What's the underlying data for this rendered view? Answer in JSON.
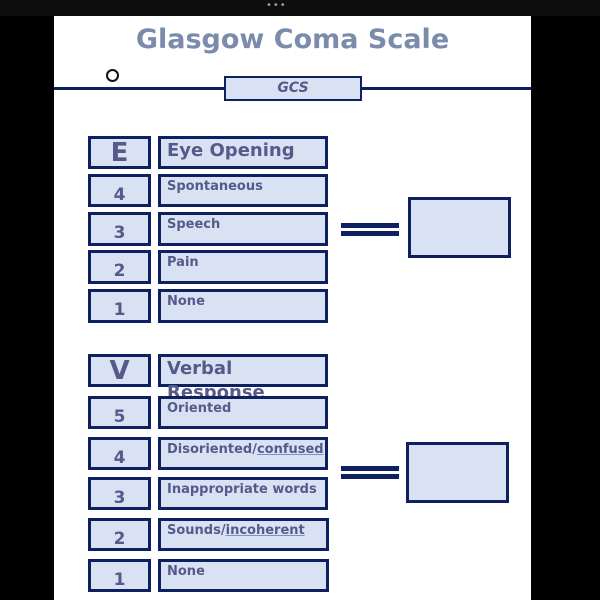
{
  "window": {
    "menu_dots": "•••"
  },
  "document": {
    "title": "Glasgow Coma Scale",
    "badge": "GCS",
    "sections": [
      {
        "letter": "E",
        "heading": "Eye Opening",
        "rows": [
          {
            "score": "4",
            "label": "Spontaneous"
          },
          {
            "score": "3",
            "label": "Speech"
          },
          {
            "score": "2",
            "label": "Pain"
          },
          {
            "score": "1",
            "label": "None"
          }
        ],
        "result_value": ""
      },
      {
        "letter": "V",
        "heading": "Verbal Response",
        "rows": [
          {
            "score": "5",
            "label": "Oriented"
          },
          {
            "score": "4",
            "label_a": "Disoriented/",
            "label_b": "confused"
          },
          {
            "score": "3",
            "label": "Inappropriate words"
          },
          {
            "score": "2",
            "label_a": "Sounds/",
            "label_b": "incoherent"
          },
          {
            "score": "1",
            "label": "None"
          }
        ],
        "result_value": ""
      }
    ]
  },
  "colors": {
    "navy": "#0f2060",
    "box_fill": "#d9e2f3",
    "text": "#555a8a",
    "title": "#7b8bab"
  }
}
